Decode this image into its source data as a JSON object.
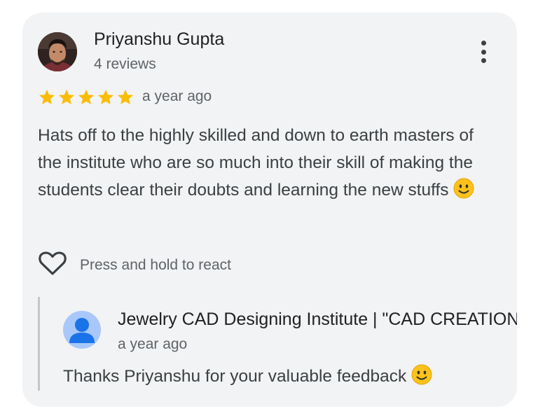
{
  "review": {
    "reviewer_name": "Priyanshu Gupta",
    "review_count": "4 reviews",
    "rating": 5,
    "time": "a year ago",
    "text": "Hats off to the highly skilled and down to earth masters of the institute who are so much into their skill of making the students clear their doubts and learning the new stuffs",
    "react_label": "Press and hold to react"
  },
  "reply": {
    "owner_name": "Jewelry CAD Designing Institute | \"CAD CREATIONS\"",
    "time": "a year ago",
    "text": "Thanks Priyanshu for your valuable feedback"
  },
  "icons": {
    "menu": "more-vert-icon",
    "star": "star-icon",
    "react": "heart-outline-icon",
    "emoji": "slightly-smiling-face-emoji",
    "owner_avatar": "person-icon"
  },
  "colors": {
    "card_background": "#f1f3f4",
    "star": "#fbbc04",
    "owner_avatar_bg": "#a8c7fa",
    "owner_avatar_fg": "#1a73e8",
    "primary_text": "#202124",
    "secondary_text": "#5f6368"
  }
}
